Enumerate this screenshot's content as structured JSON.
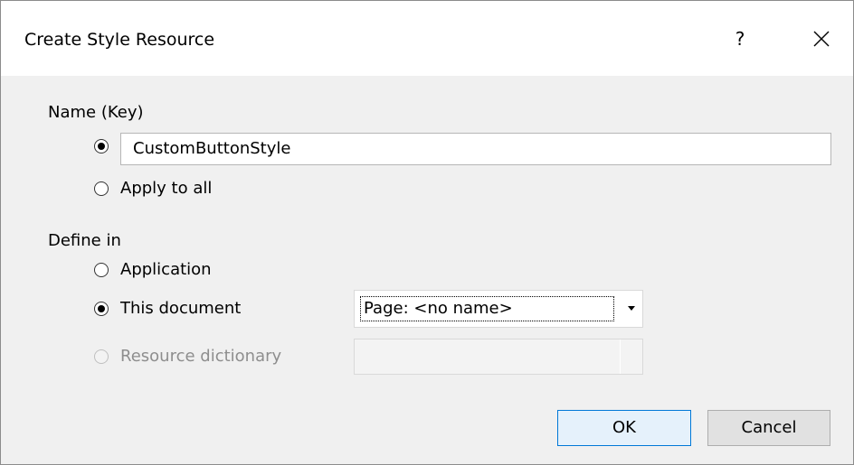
{
  "window": {
    "title": "Create Style Resource",
    "help_label": "?",
    "close_icon": "close-icon"
  },
  "name_section": {
    "heading": "Name (Key)",
    "selected_option": "name",
    "name_value": "CustomButtonStyle",
    "apply_all_label": "Apply to all"
  },
  "define_section": {
    "heading": "Define in",
    "options": [
      {
        "label": "Application",
        "checked": false,
        "enabled": true
      },
      {
        "label": "This document",
        "checked": true,
        "enabled": true
      },
      {
        "label": "Resource dictionary",
        "checked": false,
        "enabled": false
      }
    ],
    "document_combo_value": "Page: <no name>",
    "dictionary_combo_value": ""
  },
  "buttons": {
    "ok_label": "OK",
    "cancel_label": "Cancel"
  },
  "colors": {
    "dialog_background": "#f0f0f0",
    "title_background": "#ffffff",
    "default_button_border": "#0078d7",
    "default_button_fill": "#e5f1fb",
    "disabled_text": "#8e8e8e"
  }
}
